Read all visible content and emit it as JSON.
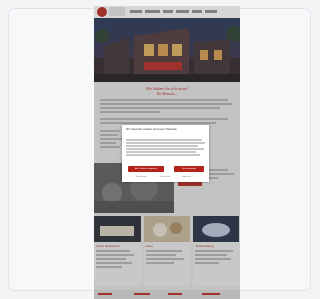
{
  "window": {
    "title": "Cookie consent on restaurant homepage"
  },
  "site": {
    "logo_alt": "site logo",
    "hero_title": "",
    "section_title": "Wie fühlen Sie sich heute?",
    "section_subtitle": "Ihr Besuch...",
    "card_titles": [
      "Unser Restaurant",
      "Hotel",
      "Veranstaltung"
    ]
  },
  "cookie_modal": {
    "title": "Wir verwenden Cookies auf unserer Webseite",
    "accept_label": "Alle Cookies akzeptieren",
    "decline_label": "Nur notwendige",
    "settings_label": "Einstellungen",
    "privacy_label": "Datenschutz",
    "imprint_label": "Impressum"
  },
  "colors": {
    "brand": "#b42318"
  }
}
